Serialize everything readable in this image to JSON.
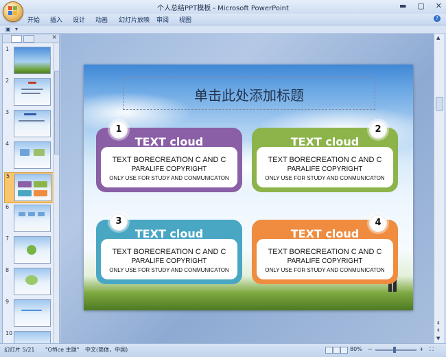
{
  "window": {
    "title": "个人总结PPT模板 - Microsoft PowerPoint"
  },
  "ribbon": {
    "tabs": [
      "开始",
      "插入",
      "设计",
      "动画",
      "幻灯片放映",
      "审阅",
      "视图"
    ]
  },
  "thumbnails": [
    {
      "num": "1"
    },
    {
      "num": "2"
    },
    {
      "num": "3"
    },
    {
      "num": "4"
    },
    {
      "num": "5"
    },
    {
      "num": "6"
    },
    {
      "num": "7"
    },
    {
      "num": "8"
    },
    {
      "num": "9"
    },
    {
      "num": "10"
    }
  ],
  "slide": {
    "title": "单击此处添加标题",
    "cards": [
      {
        "num": "1",
        "heading": "TEXT cloud",
        "line1": "TEXT BORECREATION  C AND C",
        "line2": "PARALIFE COPYRIGHT",
        "line3": "ONLY USE FOR STUDY AND CONMUNICATON",
        "color": "#8a5fa6"
      },
      {
        "num": "2",
        "heading": "TEXT cloud",
        "line1": "TEXT BORECREATION  C AND C",
        "line2": "PARALIFE COPYRIGHT",
        "line3": "ONLY USE FOR STUDY AND CONMUNICATON",
        "color": "#8db44a"
      },
      {
        "num": "3",
        "heading": "TEXT cloud",
        "line1": "TEXT BORECREATION  C AND C",
        "line2": "PARALIFE COPYRIGHT",
        "line3": "ONLY USE FOR STUDY AND CONMUNICATON",
        "color": "#49a7c4"
      },
      {
        "num": "4",
        "heading": "TEXT cloud",
        "line1": "TEXT BORECREATION  C AND C",
        "line2": "PARALIFE COPYRIGHT",
        "line3": "ONLY USE FOR STUDY AND CONMUNICATON",
        "color": "#ef8c3f"
      }
    ]
  },
  "status": {
    "slide_indicator": "幻灯片 5/21",
    "theme": "\"Office 主题\"",
    "language": "中文(简体，中国)",
    "zoom": "80%",
    "zoom_minus": "−",
    "zoom_plus": "+"
  }
}
